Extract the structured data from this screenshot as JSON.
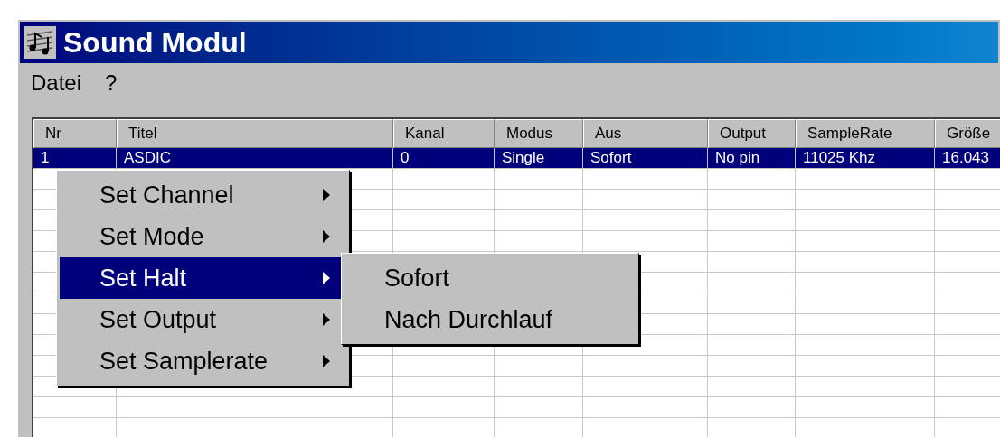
{
  "window": {
    "title": "Sound Modul"
  },
  "menu_bar": [
    "Datei",
    "?"
  ],
  "table": {
    "columns": [
      "Nr",
      "Titel",
      "Kanal",
      "Modus",
      "Aus",
      "Output",
      "SampleRate",
      "Größe"
    ],
    "rows": [
      {
        "cells": [
          "1",
          "ASDIC",
          "0",
          "Single",
          "Sofort",
          "No pin",
          "11025 Khz",
          "16.043"
        ],
        "selected": true
      }
    ]
  },
  "context_menu": {
    "items": [
      {
        "label": "Set Channel",
        "has_submenu": true,
        "selected": false
      },
      {
        "label": "Set Mode",
        "has_submenu": true,
        "selected": false
      },
      {
        "label": "Set Halt",
        "has_submenu": true,
        "selected": true
      },
      {
        "label": "Set Output",
        "has_submenu": true,
        "selected": false
      },
      {
        "label": "Set Samplerate",
        "has_submenu": true,
        "selected": false
      }
    ]
  },
  "submenu": {
    "items": [
      {
        "label": "Sofort"
      },
      {
        "label": "Nach Durchlauf"
      }
    ]
  }
}
